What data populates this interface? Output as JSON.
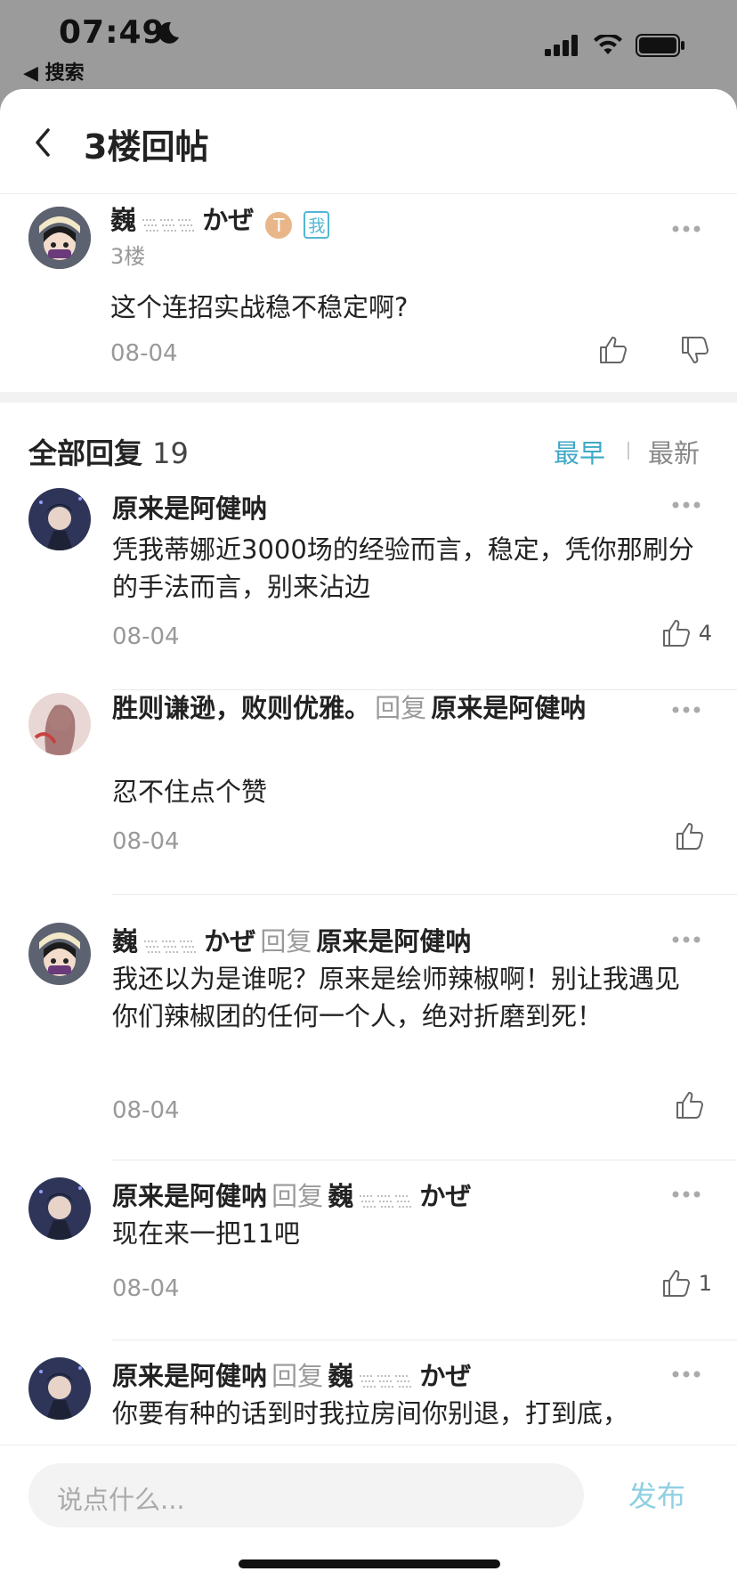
{
  "status_bar": {
    "time": "07:49",
    "back_app": "◀ 搜索"
  },
  "nav": {
    "title": "3楼回帖"
  },
  "post": {
    "author": "巍",
    "author_suffix": "かぜ",
    "badge": "T",
    "me_badge": "我",
    "floor": "3楼",
    "content": "这个连招实战稳不稳定啊?",
    "date": "08-04"
  },
  "replies_header": {
    "title": "全部回复",
    "count": "19",
    "sort_earliest": "最早",
    "sort_latest": "最新"
  },
  "replies": [
    {
      "author": "原来是阿健呐",
      "reply_label": "",
      "reply_to": "",
      "content": "凭我蒂娜近3000场的经验而言，稳定，凭你那刷分的手法而言，别来沾边",
      "date": "08-04",
      "likes": "4"
    },
    {
      "author": "胜则谦逊，败则优雅。",
      "reply_label": "回复",
      "reply_to": "原来是阿健呐",
      "content": "忍不住点个赞",
      "date": "08-04",
      "likes": ""
    },
    {
      "author": "巍",
      "author_suffix": "かぜ",
      "reply_label": "回复",
      "reply_to": "原来是阿健呐",
      "content": "我还以为是谁呢？原来是绘师辣椒啊！别让我遇见你们辣椒团的任何一个人，绝对折磨到死！",
      "date": "08-04",
      "likes": ""
    },
    {
      "author": "原来是阿健呐",
      "reply_label": "回复",
      "reply_to": "巍",
      "reply_to_suffix": "かぜ",
      "content": "现在来一把11吧",
      "date": "08-04",
      "likes": "1"
    },
    {
      "author": "原来是阿健呐",
      "reply_label": "回复",
      "reply_to": "巍",
      "reply_to_suffix": "かぜ",
      "content": "你要有种的话到时我拉房间你别退，打到底，",
      "date": "",
      "likes": ""
    }
  ],
  "composer": {
    "placeholder": "说点什么...",
    "publish_label": "发布"
  },
  "colors": {
    "accent": "#3fa8c7",
    "publish": "#8fd0e2"
  }
}
